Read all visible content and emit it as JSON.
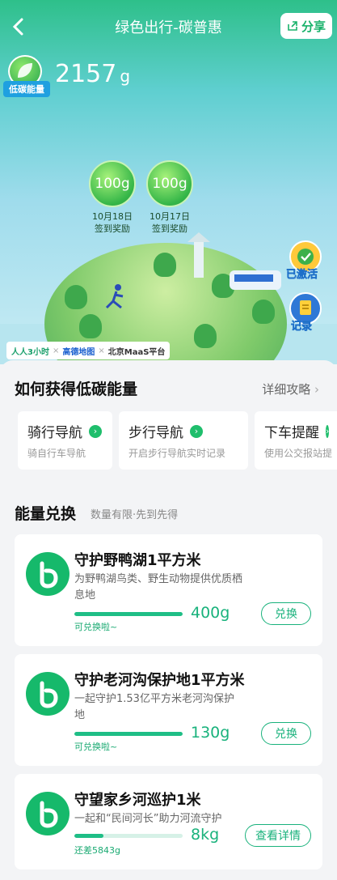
{
  "nav": {
    "title": "绿色出行-碳普惠",
    "share_label": "分享"
  },
  "hero": {
    "badge_label": "低碳能量",
    "energy_value": "2157",
    "energy_unit": "g",
    "bubbles": [
      {
        "amount": "100g",
        "date": "10月18日",
        "label": "签到奖励"
      },
      {
        "amount": "100g",
        "date": "10月17日",
        "label": "签到奖励"
      }
    ],
    "activated_label": "已激活",
    "record_label": "记录",
    "partners": [
      "人人3小时",
      "×",
      "高德地图",
      "×",
      "北京MaaS平台"
    ]
  },
  "how": {
    "title": "如何获得低碳能量",
    "link": "详细攻略",
    "methods": [
      {
        "title": "骑行导航",
        "subtitle": "骑自行车导航"
      },
      {
        "title": "步行导航",
        "subtitle": "开启步行导航实时记录"
      },
      {
        "title": "下车提醒",
        "subtitle": "使用公交报站提"
      }
    ]
  },
  "exchange": {
    "title": "能量兑换",
    "subtitle": "数量有限·先到先得",
    "items": [
      {
        "title": "守护野鸭湖1平方米",
        "desc": "为野鸭湖鸟类、野生动物提供优质栖息地",
        "cost": "400g",
        "note": "可兑换啦~",
        "progress": 1.0,
        "action": "兑换"
      },
      {
        "title": "守护老河沟保护地1平方米",
        "desc": "一起守护1.53亿平方米老河沟保护地",
        "cost": "130g",
        "note": "可兑换啦~",
        "progress": 1.0,
        "action": "兑换"
      },
      {
        "title": "守望家乡河巡护1米",
        "desc": "一起和“民间河长”助力河流守护",
        "cost": "8kg",
        "note": "还差5843g",
        "progress": 0.27,
        "action": "查看详情"
      }
    ]
  },
  "colors": {
    "brand": "#19b27c",
    "badge_blue": "#1fa0e0"
  }
}
